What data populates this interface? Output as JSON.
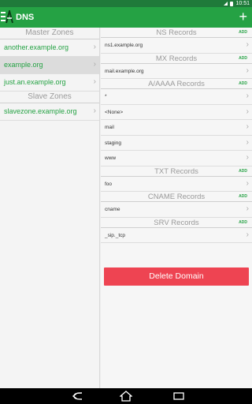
{
  "status_bar": {
    "time": "10:51"
  },
  "app": {
    "title": "DNS"
  },
  "sidebar": {
    "master_header": "Master Zones",
    "master_zones": [
      {
        "label": "another.example.org"
      },
      {
        "label": "example.org"
      },
      {
        "label": "just.an.example.org"
      }
    ],
    "slave_header": "Slave Zones",
    "slave_zones": [
      {
        "label": "slavezone.example.org"
      }
    ]
  },
  "detail": {
    "add_label": "ADD",
    "sections": [
      {
        "title": "NS Records",
        "records": [
          "ns1.example.org"
        ]
      },
      {
        "title": "MX Records",
        "records": [
          "mail.example.org"
        ]
      },
      {
        "title": "A/AAAA Records",
        "records": [
          "*",
          "<None>",
          "mail",
          "staging",
          "www"
        ]
      },
      {
        "title": "TXT Records",
        "records": [
          "foo"
        ]
      },
      {
        "title": "CNAME Records",
        "records": [
          "cname"
        ]
      },
      {
        "title": "SRV Records",
        "records": [
          "_sip._tcp"
        ]
      }
    ],
    "delete_label": "Delete Domain"
  },
  "colors": {
    "accent": "#25a244",
    "status_bar": "#1f7a3a",
    "danger": "#ee4452"
  },
  "icons": {
    "menu": "menu-icon",
    "logo": "app-logo-icon",
    "add": "plus-icon",
    "chevron": "chevron-right-icon",
    "back": "back-icon",
    "home": "home-icon",
    "recents": "recents-icon"
  }
}
